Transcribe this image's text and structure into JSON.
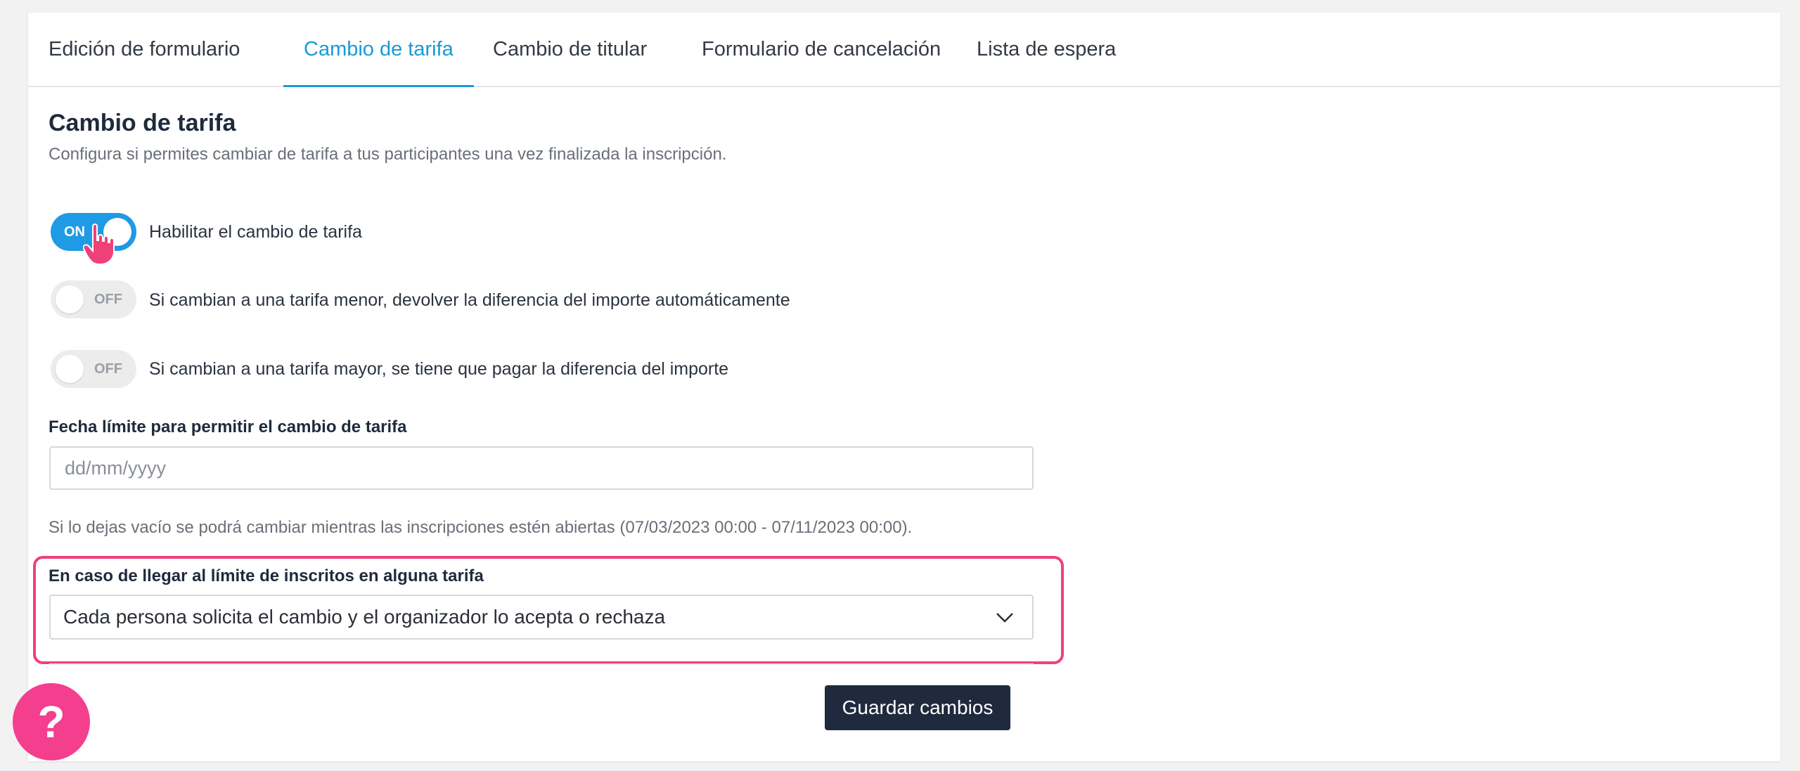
{
  "tabs": [
    {
      "label": "Edición de formulario",
      "active": false
    },
    {
      "label": "Cambio de tarifa",
      "active": true
    },
    {
      "label": "Cambio de titular",
      "active": false
    },
    {
      "label": "Formulario de cancelación",
      "active": false
    },
    {
      "label": "Lista de espera",
      "active": false
    }
  ],
  "section": {
    "title": "Cambio de tarifa",
    "subtitle": "Configura si permites cambiar de tarifa a tus participantes una vez finalizada la inscripción."
  },
  "toggles": [
    {
      "state": "ON",
      "label": "Habilitar el cambio de tarifa"
    },
    {
      "state": "OFF",
      "label": "Si cambian a una tarifa menor, devolver la diferencia del importe automáticamente"
    },
    {
      "state": "OFF",
      "label": "Si cambian a una tarifa mayor, se tiene que pagar la diferencia del importe"
    }
  ],
  "deadline": {
    "label": "Fecha límite para permitir el cambio de tarifa",
    "placeholder": "dd/mm/yyyy",
    "value": "",
    "hint": "Si lo dejas vacío se podrá cambiar mientras las inscripciones estén abiertas (07/03/2023 00:00 - 07/11/2023 00:00)."
  },
  "limit": {
    "label": "En caso de llegar al límite de inscritos en alguna tarifa",
    "selected": "Cada persona solicita el cambio y el organizador lo acepta o rechaza"
  },
  "buttons": {
    "save": "Guardar cambios",
    "help": "?"
  },
  "colors": {
    "accent": "#1a9ad6",
    "toggle_on": "#1e9be4",
    "highlight": "#f0407a",
    "save_button": "#1f2a3e",
    "help_button": "#f43e8e"
  },
  "icons": {
    "cursor": "pointing-hand-icon",
    "dropdown": "chevron-down-icon",
    "help": "help-icon"
  }
}
